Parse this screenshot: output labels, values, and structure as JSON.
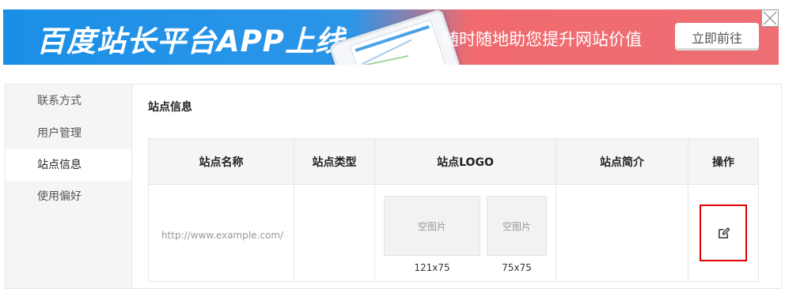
{
  "banner": {
    "title": "百度站长平台APP上线",
    "slogan": "随时随地助您提升网站价值",
    "cta_label": "立即前往",
    "gradient_left": "#1a8fe6",
    "gradient_right": "#ee6f74"
  },
  "sidebar": {
    "items": [
      {
        "label": "联系方式",
        "active": false
      },
      {
        "label": "用户管理",
        "active": false
      },
      {
        "label": "站点信息",
        "active": true
      },
      {
        "label": "使用偏好",
        "active": false
      }
    ]
  },
  "main": {
    "heading": "站点信息",
    "table": {
      "columns": [
        "站点名称",
        "站点类型",
        "站点LOGO",
        "站点简介",
        "操作"
      ],
      "rows": [
        {
          "site_name": "http://www.example.com/",
          "site_type": "",
          "logos": [
            {
              "placeholder": "空图片",
              "size": "121x75"
            },
            {
              "placeholder": "空图片",
              "size": "75x75"
            }
          ],
          "description": "",
          "action_icon": "edit-icon"
        }
      ]
    }
  },
  "icons": {
    "close": "close-icon",
    "edit": "edit-icon"
  },
  "colors": {
    "highlight_border": "#e00000",
    "sidebar_bg": "#f5f5f5",
    "header_bg": "#f5f5f5"
  }
}
